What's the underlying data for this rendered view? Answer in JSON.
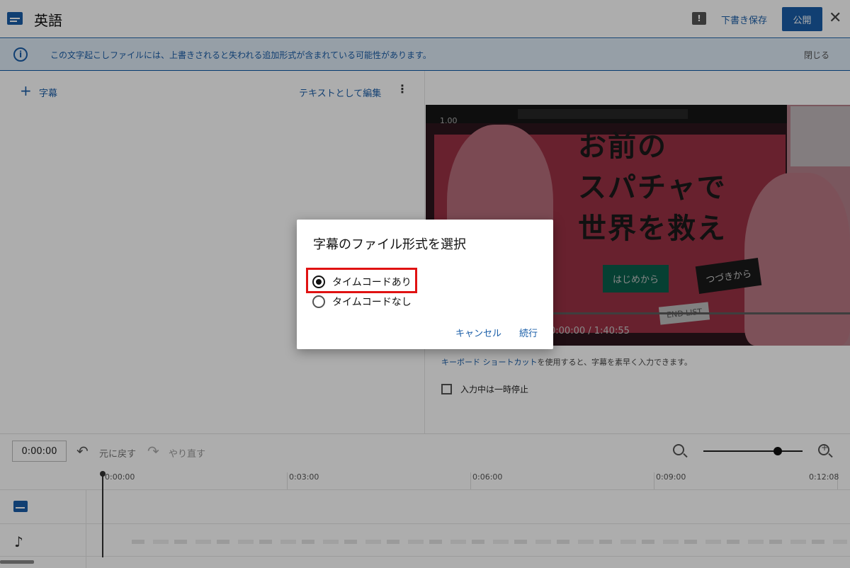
{
  "header": {
    "title": "英語",
    "feedback_glyph": "!",
    "draft_label": "下書き保存",
    "publish_label": "公開",
    "close_glyph": "✕"
  },
  "banner": {
    "info_glyph": "i",
    "message": "この文字起こしファイルには、上書きされると失われる追加形式が含まれている可能性があります。",
    "close_label": "閉じる"
  },
  "editor": {
    "add_glyph": "+",
    "add_label": "字幕",
    "edit_as_text_label": "テキストとして編集",
    "more_glyph": "⋮"
  },
  "video": {
    "speed": "1.00",
    "headline_line1": "お前の",
    "headline_line2": "スパチャで",
    "headline_line3": "世界を救え",
    "btn_start": "はじめから",
    "btn_continue": "つづきから",
    "btn_end": "END LIST",
    "time": "0:00:00 / 1:40:55"
  },
  "shortcut": {
    "link": "キーボード ショートカット",
    "text": "を使用すると、字幕を素早く入力できます。"
  },
  "pause_label": "入力中は一時停止",
  "timeline": {
    "current_time": "0:00:00",
    "undo_label": "元に戻す",
    "redo_label": "やり直す",
    "zoom_level": 0.75,
    "ruler": [
      "0:00:00",
      "0:03:00",
      "0:06:00",
      "0:09:00",
      "0:12:08"
    ]
  },
  "dialog": {
    "title": "字幕のファイル形式を選択",
    "options": [
      {
        "label": "タイムコードあり",
        "selected": true
      },
      {
        "label": "タイムコードなし",
        "selected": false
      }
    ],
    "cancel_label": "キャンセル",
    "continue_label": "続行",
    "highlight_color": "#e01212"
  }
}
